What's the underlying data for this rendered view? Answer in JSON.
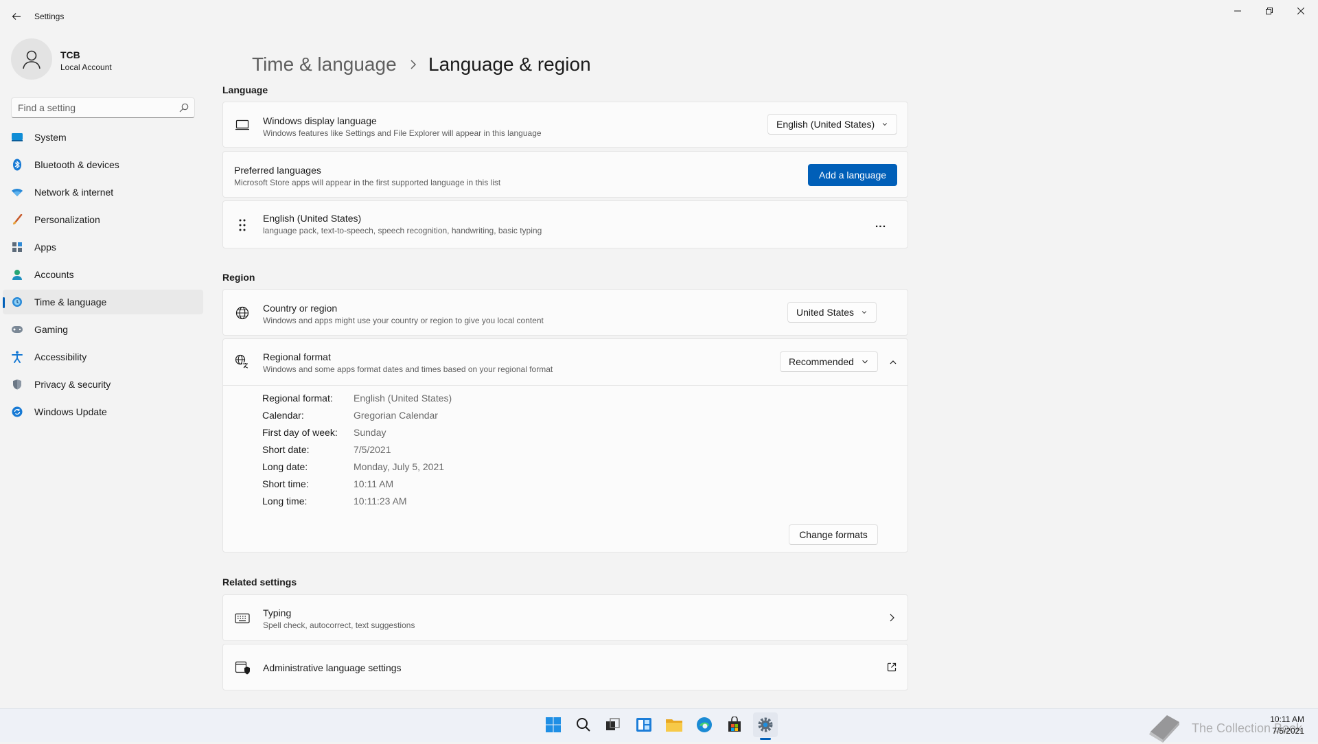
{
  "window": {
    "title": "Settings"
  },
  "user": {
    "name": "TCB",
    "account_type": "Local Account"
  },
  "search": {
    "placeholder": "Find a setting"
  },
  "sidebar": {
    "items": [
      {
        "label": "System",
        "icon": "system-icon"
      },
      {
        "label": "Bluetooth & devices",
        "icon": "bluetooth-icon"
      },
      {
        "label": "Network & internet",
        "icon": "wifi-icon"
      },
      {
        "label": "Personalization",
        "icon": "brush-icon"
      },
      {
        "label": "Apps",
        "icon": "apps-icon"
      },
      {
        "label": "Accounts",
        "icon": "person-icon"
      },
      {
        "label": "Time & language",
        "icon": "clock-globe-icon",
        "selected": true
      },
      {
        "label": "Gaming",
        "icon": "gamepad-icon"
      },
      {
        "label": "Accessibility",
        "icon": "accessibility-icon"
      },
      {
        "label": "Privacy & security",
        "icon": "shield-icon"
      },
      {
        "label": "Windows Update",
        "icon": "update-icon"
      }
    ]
  },
  "breadcrumb": {
    "parent": "Time & language",
    "current": "Language & region"
  },
  "language": {
    "section_title": "Language",
    "display_language": {
      "title": "Windows display language",
      "description": "Windows features like Settings and File Explorer will appear in this language",
      "value": "English (United States)"
    },
    "preferred": {
      "title": "Preferred languages",
      "description": "Microsoft Store apps will appear in the first supported language in this list",
      "button": "Add a language"
    },
    "installed": {
      "name": "English (United States)",
      "features": "language pack, text-to-speech, speech recognition, handwriting, basic typing",
      "more": "..."
    }
  },
  "region": {
    "section_title": "Region",
    "country": {
      "title": "Country or region",
      "description": "Windows and apps might use your country or region to give you local content",
      "value": "United States"
    },
    "format": {
      "title": "Regional format",
      "description": "Windows and some apps format dates and times based on your regional format",
      "value": "Recommended",
      "rows": [
        {
          "label": "Regional format:",
          "value": "English (United States)"
        },
        {
          "label": "Calendar:",
          "value": "Gregorian Calendar"
        },
        {
          "label": "First day of week:",
          "value": "Sunday"
        },
        {
          "label": "Short date:",
          "value": "7/5/2021"
        },
        {
          "label": "Long date:",
          "value": "Monday, July 5, 2021"
        },
        {
          "label": "Short time:",
          "value": "10:11 AM"
        },
        {
          "label": "Long time:",
          "value": "10:11:23 AM"
        }
      ],
      "change_button": "Change formats"
    }
  },
  "related": {
    "section_title": "Related settings",
    "typing": {
      "title": "Typing",
      "description": "Spell check, autocorrect, text suggestions"
    },
    "admin": {
      "title": "Administrative language settings"
    }
  },
  "taskbar": {
    "apps": [
      "start-icon",
      "search-icon",
      "task-view-icon",
      "widgets-icon",
      "file-explorer-icon",
      "edge-icon",
      "store-icon",
      "settings-icon"
    ],
    "watermark": "The Collection Book",
    "clock": {
      "time": "10:11 AM",
      "date": "7/5/2021"
    }
  },
  "colors": {
    "accent": "#005fb8",
    "background": "#f3f3f3",
    "card": "#fbfbfb"
  }
}
